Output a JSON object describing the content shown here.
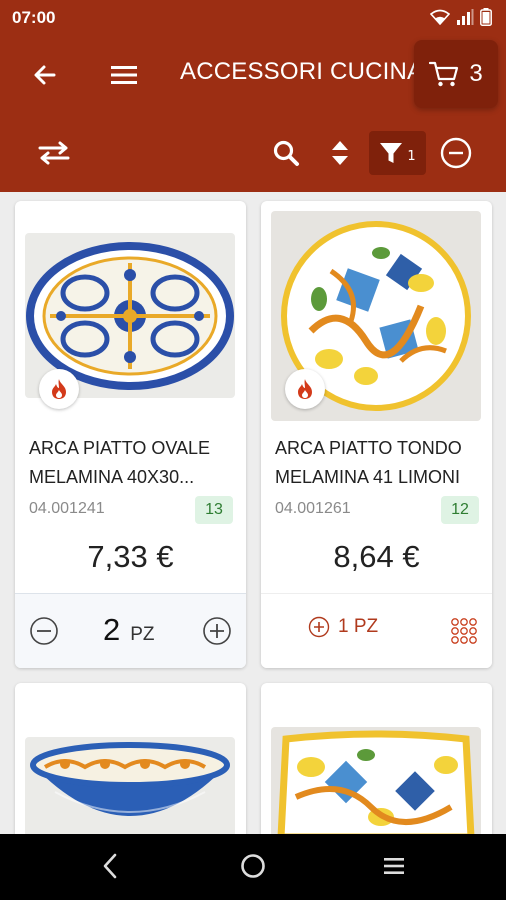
{
  "status": {
    "time": "07:00"
  },
  "header": {
    "title": "ACCESSORI CUCINA",
    "cart_count": "3",
    "filter_count": "1"
  },
  "products": [
    {
      "name": "ARCA PIATTO OVALE MELAMINA 40X30...",
      "code": "04.001241",
      "stock": "13",
      "price": "7,33 €",
      "qty": "2",
      "unit": "PZ"
    },
    {
      "name": "ARCA PIATTO TONDO MELAMINA 41 LIMONI",
      "code": "04.001261",
      "stock": "12",
      "price": "8,64 €",
      "qty_label": "1 PZ"
    }
  ],
  "colors": {
    "brand": "#9c2e13",
    "brand_dark": "#7f210b",
    "stock_bg": "#dff3e4",
    "stock_text": "#2e7d32"
  },
  "icons": [
    "back-icon",
    "menu-icon",
    "cart-icon",
    "swap-icon",
    "search-icon",
    "sort-icon",
    "filter-icon",
    "remove-circle-icon",
    "flame-icon",
    "minus-circle-icon",
    "plus-circle-icon",
    "grid-icon",
    "nav-back-icon",
    "nav-home-icon",
    "nav-menu-icon"
  ]
}
